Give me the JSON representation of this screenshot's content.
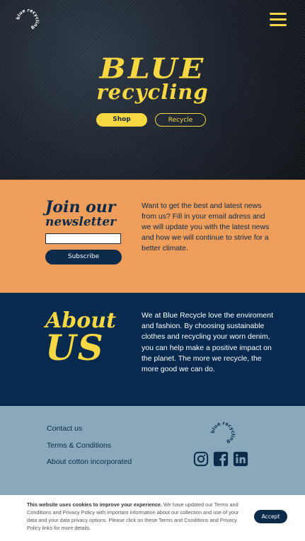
{
  "hero": {
    "brand_big": "BLUE",
    "brand_small": "recycling",
    "shop_label": "Shop",
    "recycle_label": "Recycle",
    "accent": "#f7d843"
  },
  "badge_text": "blue recycling ",
  "newsletter": {
    "title_line1": "Join our",
    "title_line2": "newsletter",
    "email_value": "",
    "subscribe_label": "Subscribe",
    "text": "Want to get the best and latest news from us? Fill in your email adress and we will update you with the latest news and how we will continue to strive for a better climate.",
    "background": "#ef9d5a"
  },
  "about": {
    "title_line1": "About",
    "title_line2": "US",
    "text": "We at Blue Recycle love the enviroment and fashion. By choosing sustainable clothes and recycling your worn denim, you can help make a positive impact on the planet. The more we recycle, the more good we can do.",
    "background": "#082a4f"
  },
  "footer": {
    "links": [
      "Contact us",
      "Terms & Conditions",
      "About cotton incorporated"
    ],
    "social_icons": [
      "instagram-icon",
      "facebook-icon",
      "linkedin-icon"
    ],
    "background": "#8aa8ba"
  },
  "cookie": {
    "bold": "This website uses cookies to improve your experience.",
    "text": " We have updated our Terms and Conditions and Privacy Policy with important information about our collection and use of your data and your data privacy options. Please click on these Terms and Conditions and Privacy Policy links for more details.",
    "accept_label": "Accept"
  }
}
